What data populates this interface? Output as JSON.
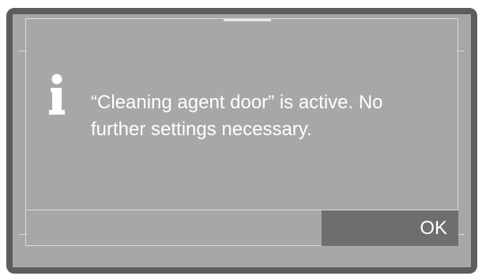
{
  "dialog": {
    "icon": "info-icon",
    "message": "“Cleaning agent door” is active. No further settings necessary.",
    "ok_label": "OK"
  },
  "colors": {
    "bezel": "#5c5d5f",
    "screen": "#a6a7a9",
    "button": "#6d6e70",
    "text": "#ffffff"
  }
}
